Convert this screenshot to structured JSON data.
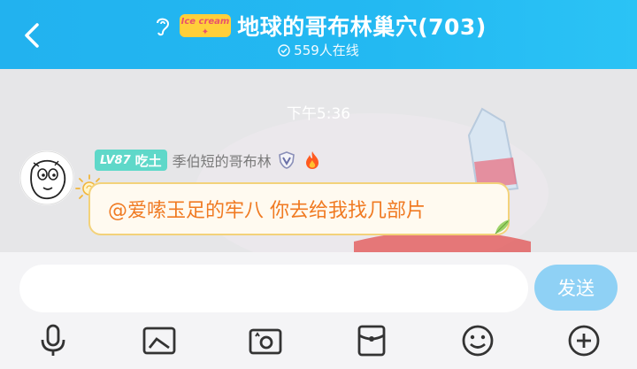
{
  "header": {
    "title": "地球的哥布林巢穴(703)",
    "online_text": "559人在线",
    "badge_text": "Ice cream"
  },
  "chat": {
    "timestamp": "下午5:36",
    "message": {
      "level": "LV87",
      "clan_tag": "吃土",
      "nickname": "季伯短的哥布林",
      "text": "@爱嗦玉足的牢八 你去给我找几部片"
    }
  },
  "input": {
    "value": "",
    "placeholder": "",
    "send_label": "发送"
  },
  "toolbar": [
    "microphone-icon",
    "image-icon",
    "camera-icon",
    "red-packet-icon",
    "emoji-icon",
    "plus-icon"
  ],
  "colors": {
    "header": "#22b2ef",
    "send_button": "#8fd1f5",
    "message_text": "#f07a22",
    "level_badge": "#5fd8c9"
  }
}
